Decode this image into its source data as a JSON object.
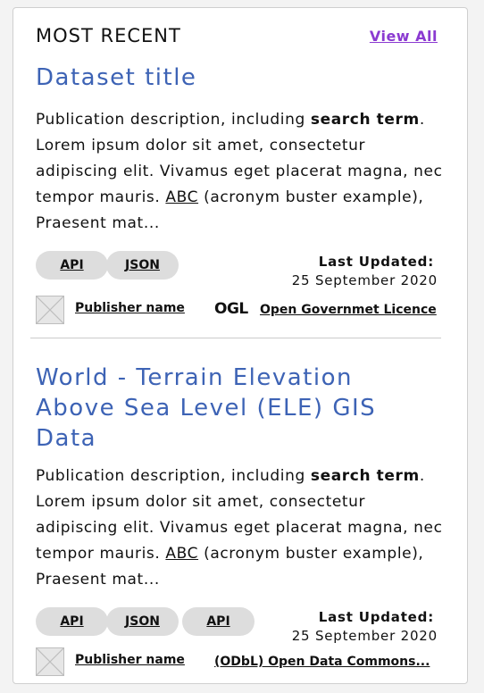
{
  "header": {
    "title": "MOST RECENT",
    "view_all": "View All"
  },
  "items": [
    {
      "title": "Dataset title",
      "desc_part1": "Publication description, including ",
      "desc_bold": "search term",
      "desc_part2": ". Lorem ipsum dolor sit amet, consectetur adipiscing elit. Vivamus eget placerat magna, nec tempor mauris. ",
      "desc_abbr": "ABC",
      "desc_part3": " (acronym buster example), Praesent mat...",
      "formats": [
        "API",
        "JSON"
      ],
      "last_updated_label": "Last Updated:",
      "last_updated_date": "25 September 2020",
      "publisher": "Publisher name",
      "licence_logo": "OGL",
      "licence": "Open Governmet Licence"
    },
    {
      "title": "World - Terrain Elevation Above Sea Level (ELE) GIS Data",
      "desc_part1": "Publication description, including ",
      "desc_bold": "search term",
      "desc_part2": ". Lorem ipsum dolor sit amet, consectetur adipiscing elit. Vivamus eget placerat magna, nec tempor mauris. ",
      "desc_abbr": "ABC",
      "desc_part3": " (acronym buster example), Praesent mat...",
      "formats": [
        "API",
        "JSON",
        "API"
      ],
      "last_updated_label": "Last Updated:",
      "last_updated_date": "25 September 2020",
      "publisher": "Publisher name",
      "licence": "(ODbL) Open Data Commons..."
    }
  ]
}
